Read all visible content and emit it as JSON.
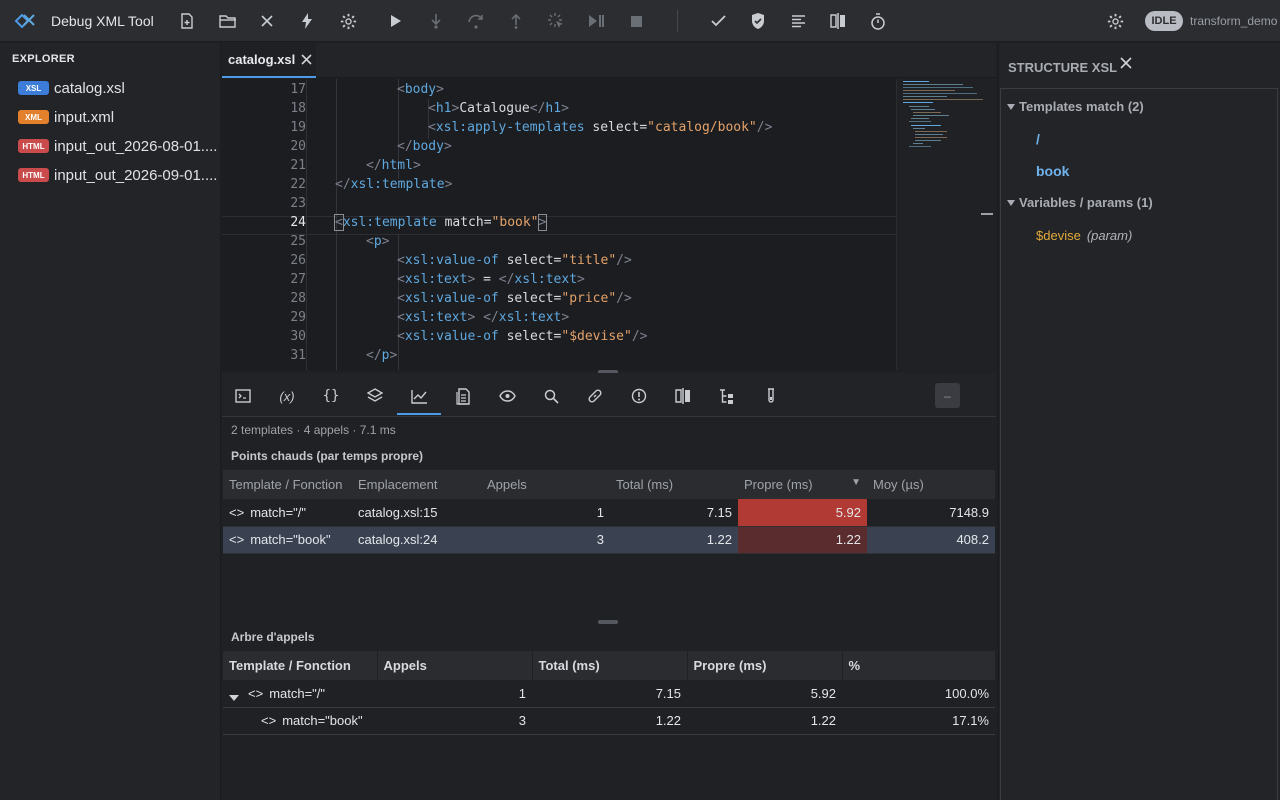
{
  "app": {
    "title": "Debug XML Tool",
    "status": "IDLE",
    "project": "transform_demo"
  },
  "toolbar": {
    "icons": [
      "new-file-icon",
      "open-folder-icon",
      "close-icon",
      "lightning-icon",
      "gear-icon",
      "play-icon",
      "step-into-icon",
      "step-over-icon",
      "step-out-icon",
      "step-cursor-icon",
      "continue-icon",
      "stop-icon",
      "check-icon",
      "shield-check-icon",
      "format-icon",
      "compare-icon",
      "stopwatch-icon",
      "settings-icon"
    ]
  },
  "explorer": {
    "title": "EXPLORER",
    "files": [
      {
        "badge": "XSL",
        "name": "catalog.xsl",
        "color": "#3b7dd8"
      },
      {
        "badge": "XML",
        "name": "input.xml",
        "color": "#e3802b"
      },
      {
        "badge": "HTML",
        "name": "input_out_2026-08-01....",
        "color": "#c94b4b"
      },
      {
        "badge": "HTML",
        "name": "input_out_2026-09-01....",
        "color": "#c94b4b"
      }
    ]
  },
  "editor": {
    "tab_label": "catalog.xsl",
    "line_numbers": [
      "17",
      "18",
      "19",
      "20",
      "21",
      "22",
      "23",
      "24",
      "25",
      "26",
      "27",
      "28",
      "29",
      "30",
      "31"
    ],
    "current_line": "24"
  },
  "panel": {
    "summary": "2 templates · 4 appels · 7.1 ms",
    "hotspots": {
      "title": "Points chauds (par temps propre)",
      "headers": [
        "Template / Fonction",
        "Emplacement",
        "Appels",
        "Total (ms)",
        "Propre (ms)",
        "Moy (µs)"
      ],
      "rows": [
        {
          "name": "match=\"/\"",
          "loc": "catalog.xsl:15",
          "calls": "1",
          "total": "7.15",
          "self": "5.92",
          "avg": "7148.9"
        },
        {
          "name": "match=\"book\"",
          "loc": "catalog.xsl:24",
          "calls": "3",
          "total": "1.22",
          "self": "1.22",
          "avg": "408.2"
        }
      ]
    },
    "calltree": {
      "title": "Arbre d'appels",
      "headers": [
        "Template / Fonction",
        "Appels",
        "Total (ms)",
        "Propre (ms)",
        "%"
      ],
      "rows": [
        {
          "name": "match=\"/\"",
          "calls": "1",
          "total": "7.15",
          "self": "5.92",
          "pct": "100.0%"
        },
        {
          "name": "match=\"book\"",
          "calls": "3",
          "total": "1.22",
          "self": "1.22",
          "pct": "17.1%"
        }
      ]
    }
  },
  "structure": {
    "title": "STRUCTURE XSL",
    "templates_label": "Templates match (2)",
    "templates": [
      "/",
      "book"
    ],
    "vars_label": "Variables / params (1)",
    "var_name": "$devise",
    "var_kind": "(param)"
  }
}
